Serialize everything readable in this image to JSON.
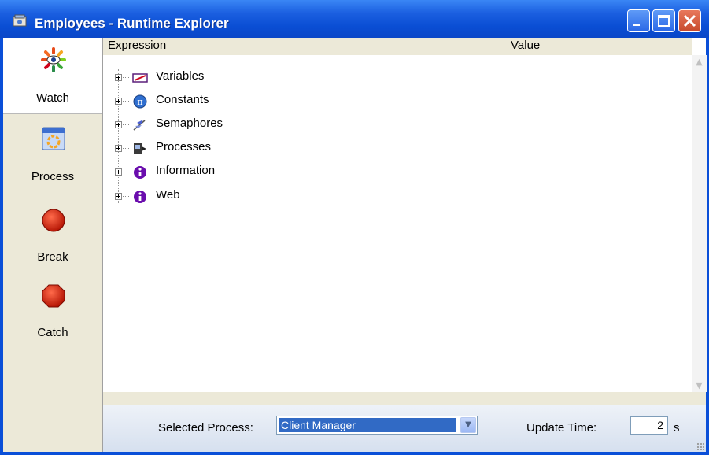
{
  "window": {
    "title": "Employees - Runtime Explorer"
  },
  "sidebar": {
    "items": [
      {
        "label": "Watch",
        "icon": "watch-eye-icon",
        "active": true
      },
      {
        "label": "Process",
        "icon": "process-window-icon",
        "active": false
      },
      {
        "label": "Break",
        "icon": "red-circle-icon",
        "active": false
      },
      {
        "label": "Catch",
        "icon": "red-octagon-icon",
        "active": false
      }
    ]
  },
  "columns": {
    "expression": "Expression",
    "value": "Value"
  },
  "tree": {
    "nodes": [
      {
        "label": "Variables",
        "icon": "variables-icon"
      },
      {
        "label": "Constants",
        "icon": "pi-icon"
      },
      {
        "label": "Semaphores",
        "icon": "semaphore-flag-icon"
      },
      {
        "label": "Processes",
        "icon": "processes-icon"
      },
      {
        "label": "Information",
        "icon": "info-icon"
      },
      {
        "label": "Web",
        "icon": "info-icon"
      }
    ]
  },
  "footer": {
    "selected_process_label": "Selected Process:",
    "selected_process_value": "Client Manager",
    "update_time_label": "Update Time:",
    "update_time_value": "2",
    "update_time_unit": "s"
  },
  "colors": {
    "titlebar": "#0a4ed4",
    "selection": "#316ac5",
    "sidebar_bg": "#ece9d8",
    "info_icon": "#6a0dad"
  }
}
